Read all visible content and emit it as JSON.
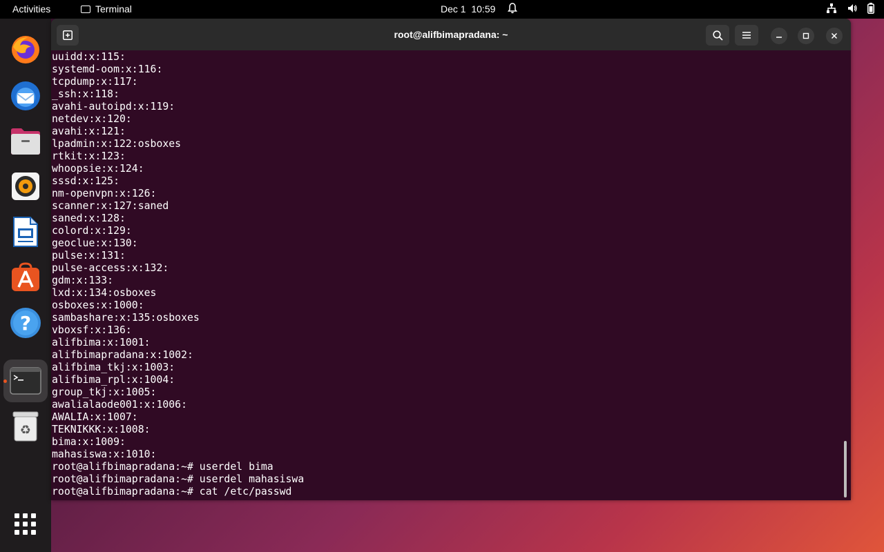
{
  "topbar": {
    "activities": "Activities",
    "app_name": "Terminal",
    "date": "Dec 1",
    "time": "10:59"
  },
  "dock": {
    "items": [
      {
        "name": "firefox-icon"
      },
      {
        "name": "thunderbird-icon"
      },
      {
        "name": "files-icon"
      },
      {
        "name": "rhythmbox-icon"
      },
      {
        "name": "libreoffice-writer-icon"
      },
      {
        "name": "software-center-icon"
      },
      {
        "name": "help-icon"
      },
      {
        "name": "terminal-icon"
      },
      {
        "name": "trash-icon"
      }
    ]
  },
  "window": {
    "title": "root@alifbimapradana: ~"
  },
  "terminal": {
    "lines": [
      "uuidd:x:115:",
      "systemd-oom:x:116:",
      "tcpdump:x:117:",
      "_ssh:x:118:",
      "avahi-autoipd:x:119:",
      "netdev:x:120:",
      "avahi:x:121:",
      "lpadmin:x:122:osboxes",
      "rtkit:x:123:",
      "whoopsie:x:124:",
      "sssd:x:125:",
      "nm-openvpn:x:126:",
      "scanner:x:127:saned",
      "saned:x:128:",
      "colord:x:129:",
      "geoclue:x:130:",
      "pulse:x:131:",
      "pulse-access:x:132:",
      "gdm:x:133:",
      "lxd:x:134:osboxes",
      "osboxes:x:1000:",
      "sambashare:x:135:osboxes",
      "vboxsf:x:136:",
      "alifbima:x:1001:",
      "alifbimapradana:x:1002:",
      "alifbima_tkj:x:1003:",
      "alifbima_rpl:x:1004:",
      "group_tkj:x:1005:",
      "awalialaode001:x:1006:",
      "AWALIA:x:1007:",
      "TEKNIKKK:x:1008:",
      "bima:x:1009:",
      "mahasiswa:x:1010:",
      "root@alifbimapradana:~# userdel bima",
      "root@alifbimapradana:~# userdel mahasiswa",
      "root@alifbimapradana:~# cat /etc/passwd"
    ]
  },
  "colors": {
    "terminal_bg": "#300a24",
    "headerbar_bg": "#2b2b2b",
    "accent": "#e95420"
  }
}
